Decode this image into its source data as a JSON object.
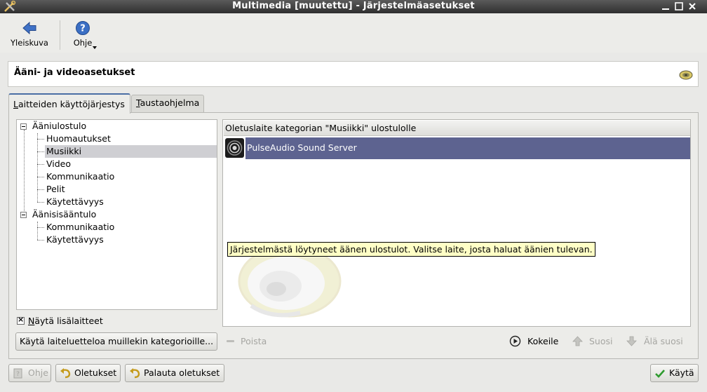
{
  "window": {
    "title": "Multimedia [muutettu] - Järjestelmäasetukset"
  },
  "toolbar": {
    "back_label": "Yleiskuva",
    "help_label": "Ohje"
  },
  "header": {
    "title": "Ääni- ja videoasetukset"
  },
  "tabs": [
    {
      "label_prefix": "L",
      "label_rest": "aitteiden käyttöjärjestys",
      "active": true
    },
    {
      "label_prefix": "T",
      "label_rest": "austaohjelma",
      "active": false
    }
  ],
  "tree": {
    "groups": [
      {
        "label": "Ääniulostulo",
        "children": [
          "Huomautukset",
          "Musiikki",
          "Video",
          "Kommunikaatio",
          "Pelit",
          "Käytettävyys"
        ]
      },
      {
        "label": "Äänisisääntulo",
        "children": [
          "Kommunikaatio",
          "Käytettävyys"
        ]
      }
    ],
    "selected": "Musiikki"
  },
  "show_more_devices": {
    "label_prefix": "N",
    "label_rest": "äytä lisälaitteet",
    "checked": true,
    "mark": "×"
  },
  "apply_list_button": {
    "label": "Käytä laiteluetteloa muillekin kategorioille..."
  },
  "device_panel": {
    "header": "Oletuslaite kategorian \"Musiikki\" ulostulolle",
    "devices": [
      "PulseAudio Sound Server"
    ],
    "tooltip": "Järjestelmästä löytyneet äänen ulostulot. Valitse laite, josta haluat äänien tulevan."
  },
  "device_actions": {
    "remove_label": "Poista",
    "test_label": "Kokeile",
    "prefer_label": "Suosi",
    "defer_label": "Älä suosi"
  },
  "bottom_buttons": {
    "help_label": "Ohje",
    "defaults_label": "Oletukset",
    "reset_label": "Palauta oletukset",
    "apply_label": "Käytä"
  },
  "colors": {
    "selection_row": "#5d6390",
    "tree_selection": "#cfcfd3",
    "tooltip_bg": "#ffffc6",
    "titlebar": "#3f3f3f",
    "back_arrow": "#3f72c7"
  }
}
